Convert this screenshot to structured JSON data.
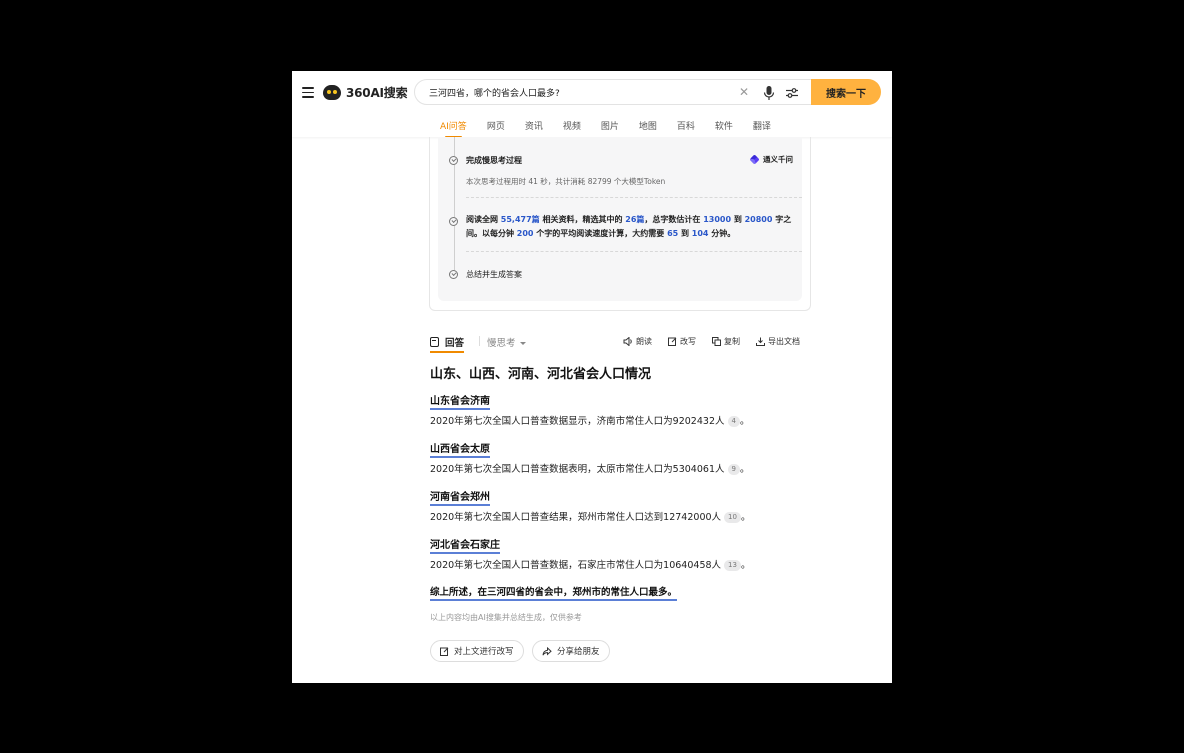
{
  "header": {
    "logo_text": "360AI搜索",
    "search_value": "三河四省，哪个的省会人口最多?",
    "search_button": "搜索一下"
  },
  "tabs": [
    "AI问答",
    "网页",
    "资讯",
    "视频",
    "图片",
    "地图",
    "百科",
    "软件",
    "翻译"
  ],
  "thinking": {
    "step1_title": "完成慢思考过程",
    "step1_sub": "本次思考过程用时 41 秒，共计消耗 82799 个大模型Token",
    "model_name": "通义千问",
    "step2": {
      "t1": "阅读全网 ",
      "articles": "55,477篇",
      "t2": " 相关资料，精选其中的 ",
      "selected": "26篇",
      "t3": "，总字数估计在 ",
      "words_min": "13000",
      "t4": " 到 ",
      "words_max": "20800",
      "t5": " 字之间。以每分钟 ",
      "speed": "200",
      "t6": " 个字的平均阅读速度计算，大约需要 ",
      "min_minutes": "65",
      "t7": " 到 ",
      "max_minutes": "104",
      "t8": " 分钟。"
    },
    "step3_title": "总结并生成答案"
  },
  "answer_bar": {
    "answer_tab": "回答",
    "slow_tab": "慢思考",
    "read": "朗读",
    "rewrite": "改写",
    "copy": "复制",
    "export": "导出文档"
  },
  "answer": {
    "title": "山东、山西、河南、河北省会人口情况",
    "sections": [
      {
        "heading": "山东省会济南",
        "text": "2020年第七次全国人口普查数据显示，济南市常住人口为9202432人",
        "cite": "4"
      },
      {
        "heading": "山西省会太原",
        "text": "2020年第七次全国人口普查数据表明，太原市常住人口为5304061人",
        "cite": "9"
      },
      {
        "heading": "河南省会郑州",
        "text": "2020年第七次全国人口普查结果，郑州市常住人口达到12742000人",
        "cite": "10"
      },
      {
        "heading": "河北省会石家庄",
        "text": "2020年第七次全国人口普查数据，石家庄市常住人口为10640458人",
        "cite": "13"
      }
    ],
    "period": "。",
    "summary": "综上所述，在三河四省的省会中，郑州市的常住人口最多。",
    "disclaimer": "以上内容均由AI搜集并总结生成，仅供参考"
  },
  "actions": {
    "rewrite_context": "对上文进行改写",
    "share": "分享给朋友"
  },
  "colors": {
    "accent": "#ffb23f",
    "active_tab": "#f08a00",
    "highlight": "#2a57c9",
    "underline": "#5b7fd6"
  }
}
